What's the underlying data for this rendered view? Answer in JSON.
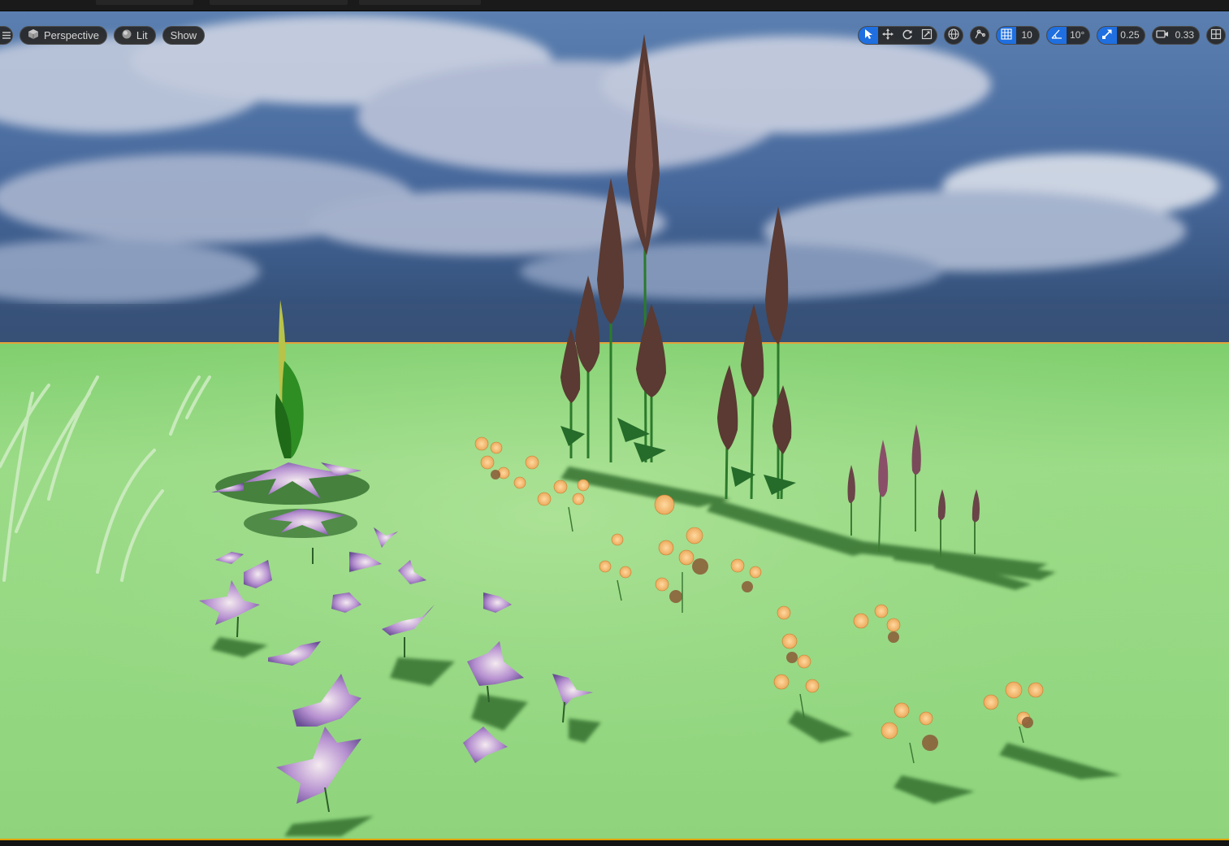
{
  "viewport": {
    "view_mode": "Perspective",
    "lighting": "Lit",
    "show": "Show"
  },
  "toolbar_right": {
    "grid_snap_value": "10",
    "rotation_snap_value": "10°",
    "scale_snap_value": "0.25",
    "camera_speed_value": "0.33"
  },
  "colors": {
    "accent_blue": "#1f6fe0",
    "selection_orange": "#e0a100",
    "ground_green": "#9bd98a",
    "sky_blue": "#3d5e8c"
  },
  "icons": {
    "menu": "hamburger-icon",
    "perspective": "cube-icon",
    "lit": "sphere-icon",
    "select": "cursor-icon",
    "translate": "move-icon",
    "rotate": "rotate-icon",
    "scale": "scale-icon",
    "world_local": "globe-icon",
    "surface_snap": "surface-snap-icon",
    "grid_snap": "grid-icon",
    "rotation_snap": "angle-icon",
    "scale_snap": "scale-arrow-icon",
    "camera_speed": "camera-icon",
    "layout": "viewport-layout-icon"
  }
}
